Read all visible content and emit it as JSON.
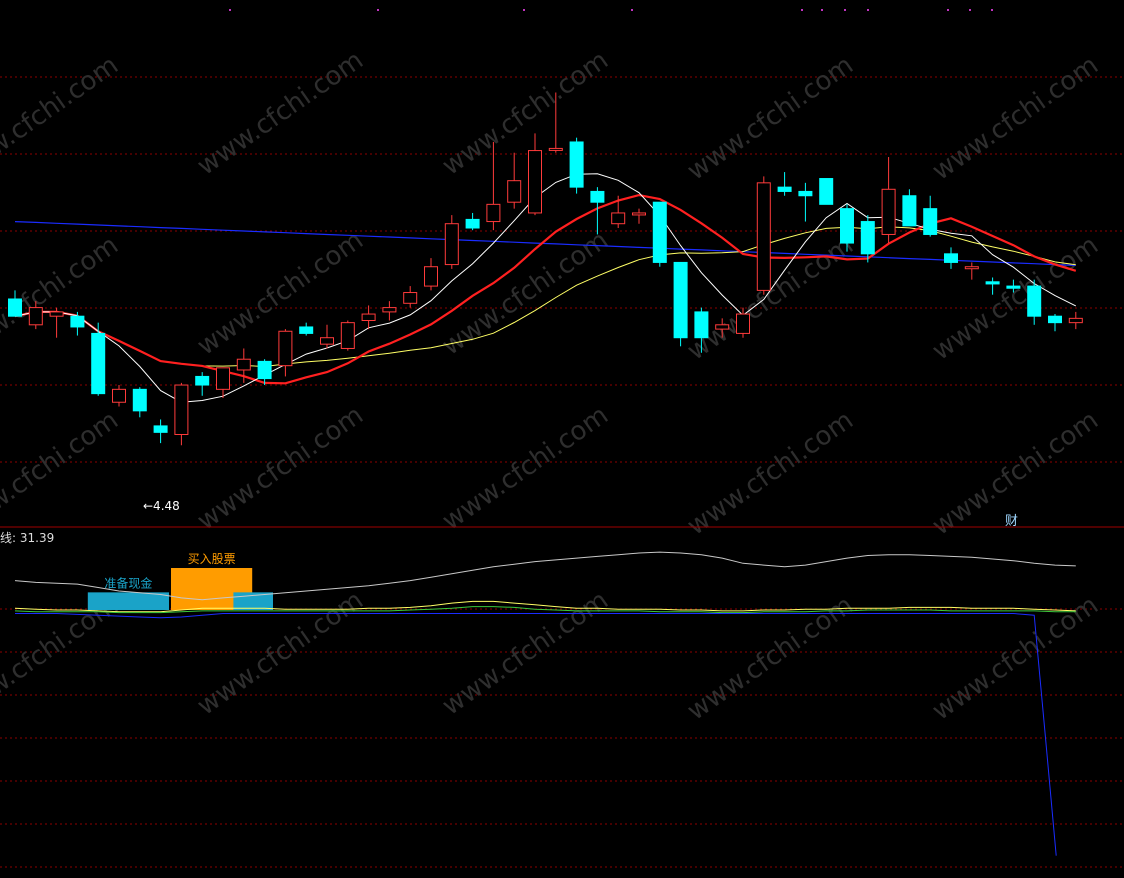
{
  "watermark": "www.cfchi.com",
  "price_panel": {
    "low_marker_label": "←4.48",
    "corner_char": "财"
  },
  "indicator_panel": {
    "line_label": "线: 31.39",
    "blocks": [
      {
        "label": "准备现金",
        "color": "#1aa3c8",
        "start_index": 4,
        "end_index": 7,
        "level": 0.42
      },
      {
        "label": "买入股票",
        "color": "#ff9c00",
        "start_index": 8,
        "end_index": 11,
        "level": 1.0
      },
      {
        "label": "",
        "color": "#1aa3c8",
        "start_index": 11,
        "end_index": 12,
        "level": 0.42
      }
    ]
  },
  "colors": {
    "up": "#ff3b3b",
    "down": "#00ffff",
    "ma_short": "#ffffff",
    "ma_mid": "#ff2020",
    "ma_long": "#ffff66",
    "ma_very_long": "#1a2cff",
    "grid": "#8b0000"
  },
  "chart_data": [
    {
      "type": "candlestick",
      "title": "",
      "note": "Values are relative price units estimated from the chart; only the 4.48 low is printed.",
      "candles": [
        {
          "o": 5.16,
          "h": 5.2,
          "l": 5.08,
          "c": 5.08
        },
        {
          "o": 5.04,
          "h": 5.15,
          "l": 5.02,
          "c": 5.12
        },
        {
          "o": 5.08,
          "h": 5.12,
          "l": 4.98,
          "c": 5.1
        },
        {
          "o": 5.08,
          "h": 5.1,
          "l": 4.99,
          "c": 5.03
        },
        {
          "o": 5.0,
          "h": 5.05,
          "l": 4.71,
          "c": 4.72
        },
        {
          "o": 4.68,
          "h": 4.76,
          "l": 4.66,
          "c": 4.74
        },
        {
          "o": 4.74,
          "h": 4.75,
          "l": 4.61,
          "c": 4.64
        },
        {
          "o": 4.57,
          "h": 4.6,
          "l": 4.49,
          "c": 4.54
        },
        {
          "o": 4.53,
          "h": 4.77,
          "l": 4.48,
          "c": 4.76
        },
        {
          "o": 4.8,
          "h": 4.82,
          "l": 4.71,
          "c": 4.76
        },
        {
          "o": 4.74,
          "h": 4.84,
          "l": 4.7,
          "c": 4.84
        },
        {
          "o": 4.83,
          "h": 4.93,
          "l": 4.77,
          "c": 4.88
        },
        {
          "o": 4.87,
          "h": 4.88,
          "l": 4.76,
          "c": 4.79
        },
        {
          "o": 4.85,
          "h": 5.02,
          "l": 4.8,
          "c": 5.01
        },
        {
          "o": 5.03,
          "h": 5.05,
          "l": 4.99,
          "c": 5.0
        },
        {
          "o": 4.95,
          "h": 5.04,
          "l": 4.93,
          "c": 4.98
        },
        {
          "o": 4.93,
          "h": 5.06,
          "l": 4.92,
          "c": 5.05
        },
        {
          "o": 5.06,
          "h": 5.13,
          "l": 5.02,
          "c": 5.09
        },
        {
          "o": 5.1,
          "h": 5.15,
          "l": 5.06,
          "c": 5.12
        },
        {
          "o": 5.14,
          "h": 5.22,
          "l": 5.12,
          "c": 5.19
        },
        {
          "o": 5.22,
          "h": 5.35,
          "l": 5.2,
          "c": 5.31
        },
        {
          "o": 5.32,
          "h": 5.55,
          "l": 5.3,
          "c": 5.51
        },
        {
          "o": 5.53,
          "h": 5.56,
          "l": 5.48,
          "c": 5.49
        },
        {
          "o": 5.52,
          "h": 5.89,
          "l": 5.48,
          "c": 5.6
        },
        {
          "o": 5.61,
          "h": 5.84,
          "l": 5.58,
          "c": 5.71
        },
        {
          "o": 5.56,
          "h": 5.93,
          "l": 5.55,
          "c": 5.85
        },
        {
          "o": 5.86,
          "h": 6.12,
          "l": 5.84,
          "c": 5.86
        },
        {
          "o": 5.89,
          "h": 5.91,
          "l": 5.65,
          "c": 5.68
        },
        {
          "o": 5.66,
          "h": 5.68,
          "l": 5.46,
          "c": 5.61
        },
        {
          "o": 5.51,
          "h": 5.64,
          "l": 5.49,
          "c": 5.56
        },
        {
          "o": 5.56,
          "h": 5.58,
          "l": 5.51,
          "c": 5.56
        },
        {
          "o": 5.61,
          "h": 5.61,
          "l": 5.31,
          "c": 5.33
        },
        {
          "o": 5.33,
          "h": 5.33,
          "l": 4.94,
          "c": 4.98
        },
        {
          "o": 5.1,
          "h": 5.12,
          "l": 4.91,
          "c": 4.98
        },
        {
          "o": 5.02,
          "h": 5.07,
          "l": 4.98,
          "c": 5.04
        },
        {
          "o": 5.0,
          "h": 5.12,
          "l": 4.98,
          "c": 5.09
        },
        {
          "o": 5.2,
          "h": 5.73,
          "l": 5.18,
          "c": 5.7
        },
        {
          "o": 5.68,
          "h": 5.75,
          "l": 5.64,
          "c": 5.66
        },
        {
          "o": 5.66,
          "h": 5.7,
          "l": 5.52,
          "c": 5.64
        },
        {
          "o": 5.72,
          "h": 5.72,
          "l": 5.61,
          "c": 5.6
        },
        {
          "o": 5.58,
          "h": 5.6,
          "l": 5.38,
          "c": 5.42
        },
        {
          "o": 5.52,
          "h": 5.55,
          "l": 5.33,
          "c": 5.37
        },
        {
          "o": 5.46,
          "h": 5.82,
          "l": 5.42,
          "c": 5.67
        },
        {
          "o": 5.64,
          "h": 5.67,
          "l": 5.5,
          "c": 5.5
        },
        {
          "o": 5.58,
          "h": 5.64,
          "l": 5.45,
          "c": 5.46
        },
        {
          "o": 5.37,
          "h": 5.4,
          "l": 5.3,
          "c": 5.33
        },
        {
          "o": 5.31,
          "h": 5.33,
          "l": 5.25,
          "c": 5.31
        },
        {
          "o": 5.24,
          "h": 5.26,
          "l": 5.18,
          "c": 5.23
        },
        {
          "o": 5.22,
          "h": 5.25,
          "l": 5.19,
          "c": 5.21
        },
        {
          "o": 5.22,
          "h": 5.25,
          "l": 5.04,
          "c": 5.08
        },
        {
          "o": 5.08,
          "h": 5.09,
          "l": 5.01,
          "c": 5.05
        },
        {
          "o": 5.05,
          "h": 5.1,
          "l": 5.02,
          "c": 5.07
        }
      ],
      "ylim": [
        4.1,
        6.55
      ]
    },
    {
      "type": "line",
      "title": "",
      "label": "线: 31.39",
      "series": [
        {
          "color": "#c8c8c8",
          "values": [
            38,
            36,
            35,
            34,
            30,
            26,
            24,
            22,
            18,
            16,
            18,
            20,
            22,
            24,
            26,
            28,
            30,
            32,
            35,
            38,
            42,
            46,
            50,
            54,
            57,
            60,
            62,
            64,
            66,
            68,
            70,
            71,
            70,
            68,
            64,
            58,
            56,
            54,
            56,
            60,
            64,
            67,
            68,
            68,
            67,
            66,
            65,
            63,
            61,
            58,
            56,
            55
          ]
        },
        {
          "color": "#ffff66",
          "values": [
            6,
            5,
            4,
            4,
            3,
            2,
            2,
            2,
            4,
            6,
            6,
            6,
            6,
            5,
            5,
            5,
            5,
            6,
            6,
            7,
            9,
            12,
            14,
            14,
            12,
            10,
            8,
            6,
            6,
            5,
            5,
            5,
            4,
            4,
            3,
            3,
            4,
            4,
            5,
            5,
            6,
            6,
            6,
            7,
            7,
            7,
            6,
            6,
            6,
            5,
            4,
            3
          ]
        },
        {
          "color": "#3cc83c",
          "values": [
            3,
            2,
            2,
            2,
            2,
            1,
            1,
            1,
            2,
            3,
            3,
            3,
            3,
            3,
            3,
            3,
            3,
            3,
            3,
            4,
            5,
            6,
            8,
            8,
            7,
            5,
            4,
            3,
            3,
            3,
            3,
            2,
            2,
            2,
            1,
            1,
            2,
            2,
            2,
            3,
            3,
            4,
            4,
            4,
            4,
            3,
            3,
            3,
            3,
            3,
            2,
            2
          ]
        },
        {
          "color": "#1a2cff",
          "values": [
            0,
            0,
            0,
            -1,
            -2,
            -3,
            -4,
            -5,
            -4,
            -2,
            0,
            0,
            0,
            0,
            0,
            0,
            0,
            0,
            0,
            0,
            0,
            0,
            0,
            0,
            0,
            0,
            0,
            0,
            0,
            0,
            0,
            0,
            0,
            0,
            0,
            0,
            0,
            0,
            0,
            0,
            0,
            0,
            0,
            0,
            0,
            0,
            0,
            0,
            0,
            -2,
            -140,
            -280
          ]
        }
      ],
      "ylim": [
        -300,
        100
      ]
    }
  ]
}
